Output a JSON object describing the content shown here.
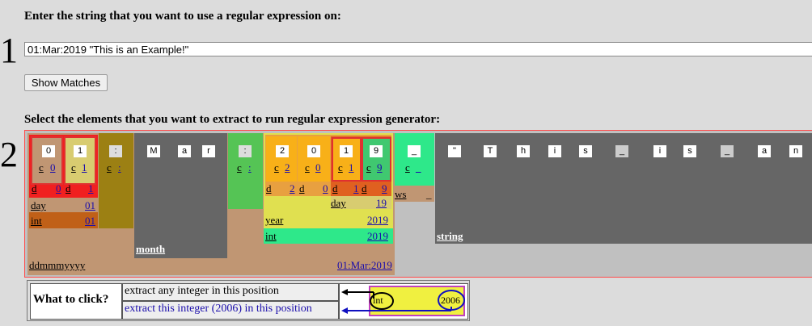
{
  "step1": {
    "number": "1",
    "heading": "Enter the string that you want to use a regular expression on:",
    "input_value": "01:Mar:2019 \"This is an Example!\"",
    "button_label": "Show Matches"
  },
  "step2": {
    "number": "2",
    "heading": "Select the elements that you want to extract to run regular expression generator:"
  },
  "chars": {
    "c0": "0",
    "c1": "1",
    "colon1": ":",
    "M": "M",
    "a": "a",
    "r": "r",
    "colon2": ":",
    "c2": "2",
    "c0b": "0",
    "c1b": "1",
    "c9": "9",
    "space": "_",
    "quote": "\"",
    "T": "T",
    "h": "h",
    "i": "i",
    "s": "s",
    "sp2": "_",
    "i2": "i",
    "s2": "s",
    "sp3": "_",
    "a2": "a",
    "n": "n"
  },
  "labels": {
    "c": "c",
    "d": "d",
    "v0": "0",
    "v1": "1",
    "vcolon": ":",
    "v2": "2",
    "v9": "9",
    "vspace": "_",
    "day": "day",
    "day_val": "01",
    "int": "int",
    "int_val": "01",
    "month": "month",
    "year": "year",
    "year_val": "2019",
    "day2": "day",
    "day2_val": "19",
    "int2": "int",
    "int2_val": "2019",
    "ws": "ws",
    "ws_val": "_",
    "string": "string",
    "ddmmmyyyy": "ddmmmyyyy",
    "date_val": "01:Mar:2019"
  },
  "legend": {
    "title": "What to click?",
    "row1": "extract any integer in this position",
    "row2": "extract this integer (2006) in this position",
    "icon_int": "int",
    "icon_val": "2006"
  },
  "colors": {
    "bg": "#dcdcdc",
    "tan": "#c09673",
    "olive": "#9c8013",
    "darkgray": "#666666",
    "green": "#55c455",
    "yellow": "#e0e050",
    "mint": "#2ee88a",
    "orange": "#f0a020",
    "red": "#f02020"
  }
}
